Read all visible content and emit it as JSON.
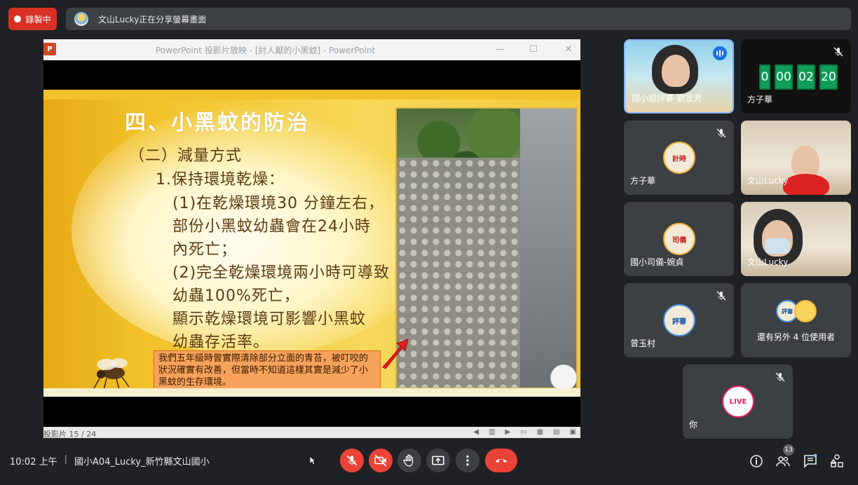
{
  "top_bar": {
    "recording_label": "錄製中",
    "share_banner_text": "文山Lucky正在分享螢幕畫面"
  },
  "presentation": {
    "window_title": "PowerPoint 投影片放映 - [討人厭的小黑蚊] - PowerPoint",
    "logo_text": "P",
    "slide_counter": "投影片 15 / 24",
    "slide": {
      "heading": "四、小黑蚊的防治",
      "lines": [
        "（二）減量方式",
        "1.保持環境乾燥：",
        "(1)在乾燥環境30 分鐘左右，",
        "部份小黑蚊幼蟲會在24小時",
        "內死亡；",
        "(2)完全乾燥環境兩小時可導致",
        "幼蟲100%死亡，",
        "顯示乾燥環境可影響小黑蚊",
        "幼蟲存活率。"
      ],
      "note": "我們五年級時曾實際清除部分立面的青苔，被叮咬的狀況確實有改善，但當時不知道這樣其實是減少了小黑蚊的生存環境。"
    }
  },
  "participants": {
    "tile1": {
      "name": "國小組評審-劉宜芳"
    },
    "tile2": {
      "name": "方子華",
      "timer": [
        "0",
        "00",
        "02",
        "20"
      ]
    },
    "tile3": {
      "name": "方子華",
      "avatar_text": "計時"
    },
    "tile4": {
      "name": "文山Lucky"
    },
    "tile5": {
      "name": "國小司儀-婉貞",
      "avatar_text": "司儀"
    },
    "tile6": {
      "name": "文山Lucky"
    },
    "tile7": {
      "name": "曾玉村",
      "avatar_text": "評審"
    },
    "tile8": {
      "label": "還有另外 4 位使用者",
      "avatar1_text": "評審"
    },
    "tile9": {
      "name": "你",
      "avatar_text": "LIVE"
    }
  },
  "bottom_bar": {
    "time": "10:02 上午",
    "separator": "|",
    "meeting_name": "國小A04_Lucky_新竹縣文山國小",
    "people_count": "13"
  },
  "colors": {
    "background": "#202124",
    "tile": "#3c4043",
    "danger": "#ea4335",
    "accent": "#1a73e8"
  }
}
